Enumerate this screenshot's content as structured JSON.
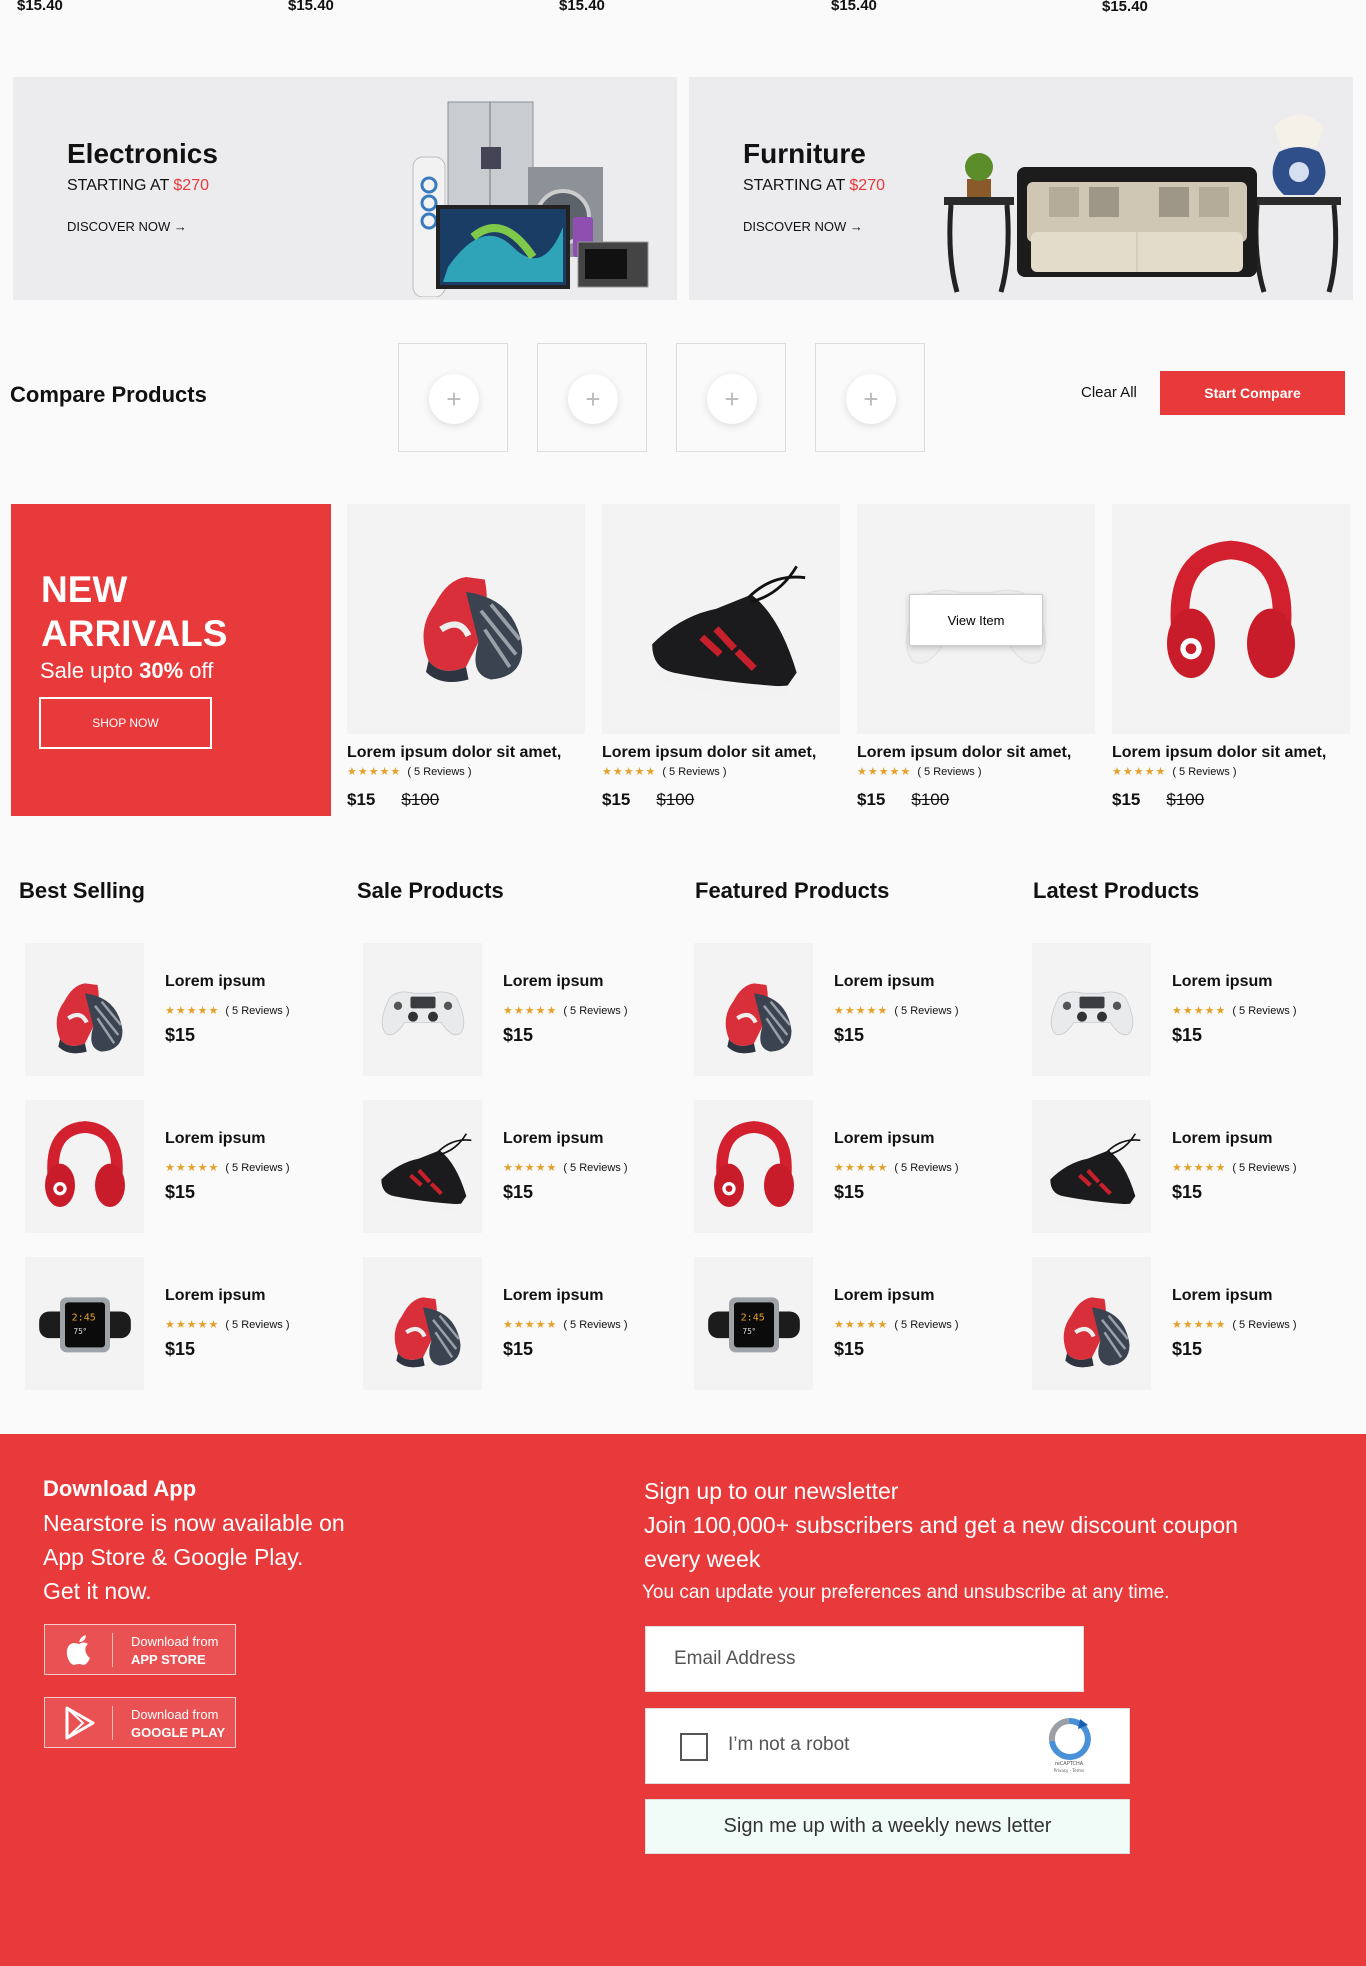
{
  "top_prices": [
    "$15.40",
    "$15.40",
    "$15.40",
    "$15.40",
    "$15.40"
  ],
  "banners": [
    {
      "title": "Electronics",
      "starting": "STARTING AT",
      "price": "$270",
      "discover": "DISCOVER NOW →"
    },
    {
      "title": "Furniture",
      "starting": "STARTING AT",
      "price": "$270",
      "discover": "DISCOVER NOW →"
    }
  ],
  "compare": {
    "title": "Compare Products",
    "slot_icon": "+",
    "clear_label": "Clear All",
    "start_label": "Start Compare"
  },
  "new_arrivals": {
    "title": "NEW ARRIVALS",
    "sale_prefix": "Sale upto",
    "sale_value": "30%",
    "sale_suffix": "off",
    "shop_label": "SHOP NOW"
  },
  "arrival_cards": [
    {
      "title": "Lorem ipsum dolor sit amet,",
      "stars": "★★★★★",
      "reviews": "( 5 Reviews )",
      "price": "$15",
      "old_price": "$100",
      "image": "red-sneaker"
    },
    {
      "title": "Lorem ipsum dolor sit amet,",
      "stars": "★★★★★",
      "reviews": "( 5 Reviews )",
      "price": "$15",
      "old_price": "$100",
      "image": "black-sneaker"
    },
    {
      "title": "Lorem ipsum dolor sit amet,",
      "stars": "★★★★★",
      "reviews": "( 5 Reviews )",
      "price": "$15",
      "old_price": "$100",
      "image": "game-controller",
      "view_label": "View Item"
    },
    {
      "title": "Lorem ipsum dolor sit amet,",
      "stars": "★★★★★",
      "reviews": "( 5 Reviews )",
      "price": "$15",
      "old_price": "$100",
      "image": "red-headphones"
    }
  ],
  "lists": [
    {
      "title": "Best Selling",
      "items": [
        {
          "name": "Lorem ipsum",
          "stars": "★★★★★",
          "reviews": "( 5 Reviews )",
          "price": "$15",
          "image": "red-sneaker"
        },
        {
          "name": "Lorem ipsum",
          "stars": "★★★★★",
          "reviews": "( 5 Reviews )",
          "price": "$15",
          "image": "red-headphones"
        },
        {
          "name": "Lorem ipsum",
          "stars": "★★★★★",
          "reviews": "( 5 Reviews )",
          "price": "$15",
          "image": "smart-watch"
        }
      ]
    },
    {
      "title": "Sale Products",
      "items": [
        {
          "name": "Lorem ipsum",
          "stars": "★★★★★",
          "reviews": "( 5 Reviews )",
          "price": "$15",
          "image": "game-controller"
        },
        {
          "name": "Lorem ipsum",
          "stars": "★★★★★",
          "reviews": "( 5 Reviews )",
          "price": "$15",
          "image": "black-sneaker"
        },
        {
          "name": "Lorem ipsum",
          "stars": "★★★★★",
          "reviews": "( 5 Reviews )",
          "price": "$15",
          "image": "red-sneaker"
        }
      ]
    },
    {
      "title": "Featured Products",
      "items": [
        {
          "name": "Lorem ipsum",
          "stars": "★★★★★",
          "reviews": "( 5 Reviews )",
          "price": "$15",
          "image": "red-sneaker"
        },
        {
          "name": "Lorem ipsum",
          "stars": "★★★★★",
          "reviews": "( 5 Reviews )",
          "price": "$15",
          "image": "red-headphones"
        },
        {
          "name": "Lorem ipsum",
          "stars": "★★★★★",
          "reviews": "( 5 Reviews )",
          "price": "$15",
          "image": "smart-watch"
        }
      ]
    },
    {
      "title": "Latest Products",
      "items": [
        {
          "name": "Lorem ipsum",
          "stars": "★★★★★",
          "reviews": "( 5 Reviews )",
          "price": "$15",
          "image": "game-controller"
        },
        {
          "name": "Lorem ipsum",
          "stars": "★★★★★",
          "reviews": "( 5 Reviews )",
          "price": "$15",
          "image": "black-sneaker"
        },
        {
          "name": "Lorem ipsum",
          "stars": "★★★★★",
          "reviews": "( 5 Reviews )",
          "price": "$15",
          "image": "red-sneaker"
        }
      ]
    }
  ],
  "footer": {
    "app_title": "Download App",
    "app_lines": [
      "Nearstore is now available on",
      "App Store & Google Play.",
      "Get it now."
    ],
    "app_store": {
      "line1": "Download from",
      "line2": "APP STORE",
      "icon": "apple-icon"
    },
    "google_play": {
      "line1": "Download from",
      "line2": "GOOGLE PLAY",
      "icon": "play-icon"
    },
    "newsletter_lines": [
      "Sign up to our newsletter",
      "Join 100,000+ subscribers and get a new discount coupon",
      "every week"
    ],
    "newsletter_sub": "You can update your preferences and unsubscribe at any time.",
    "email_placeholder": "Email Address",
    "captcha_label": "I’m not a robot",
    "captcha_brand": "reCAPTCHA",
    "captcha_links": "Privacy - Terms",
    "signup_label": "Sign me up with a weekly news letter"
  },
  "colors": {
    "accent": "#e8393b",
    "star": "#e4a12a",
    "banner_bg": "#ececee",
    "thumb_bg": "#f3f3f3"
  }
}
